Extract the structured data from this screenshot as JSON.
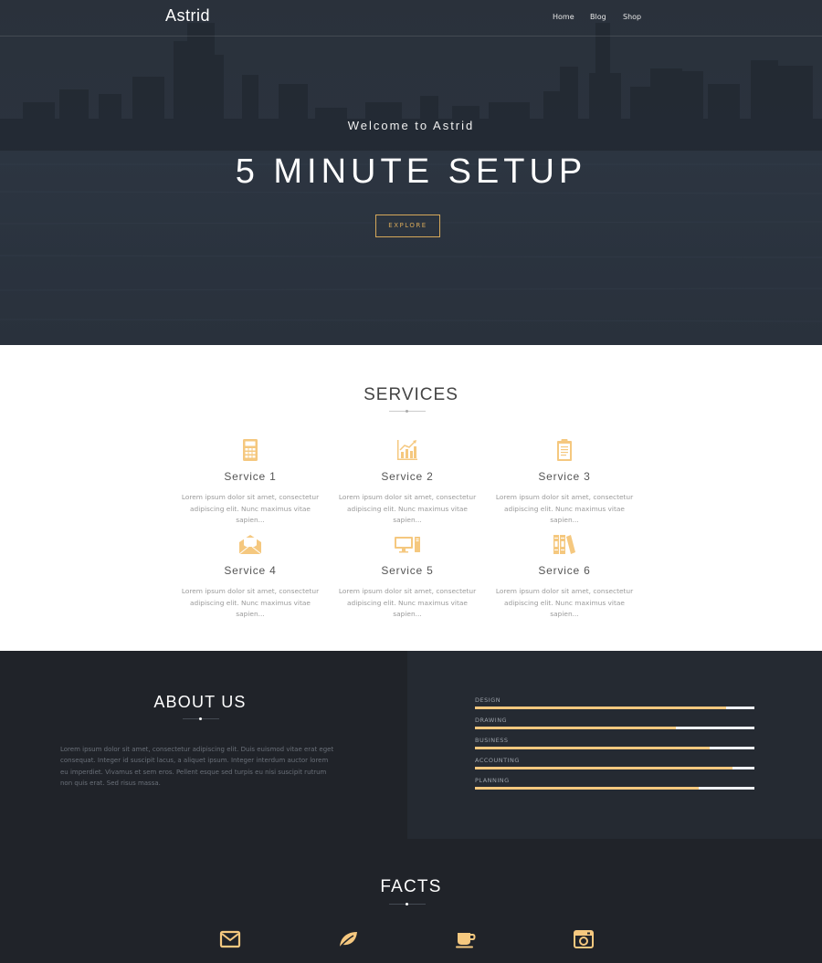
{
  "colors": {
    "accent": "#f5c87f",
    "dark": "#202329",
    "panel": "#252a32",
    "explore_border": "#d6a85a"
  },
  "nav": {
    "logo": "Astrid",
    "items": [
      "Home",
      "Blog",
      "Shop"
    ]
  },
  "hero": {
    "welcome": "Welcome to Astrid",
    "headline": "5 MINUTE SETUP",
    "button": "EXPLORE"
  },
  "services": {
    "title": "SERVICES",
    "items": [
      {
        "name": "Service 1",
        "icon": "calculator-icon",
        "text": "Lorem ipsum dolor sit amet, consectetur adipiscing elit. Nunc maximus vitae sapien..."
      },
      {
        "name": "Service 2",
        "icon": "chart-icon",
        "text": "Lorem ipsum dolor sit amet, consectetur adipiscing elit. Nunc maximus vitae sapien..."
      },
      {
        "name": "Service 3",
        "icon": "clipboard-icon",
        "text": "Lorem ipsum dolor sit amet, consectetur adipiscing elit. Nunc maximus vitae sapien..."
      },
      {
        "name": "Service 4",
        "icon": "envelope-open-icon",
        "text": "Lorem ipsum dolor sit amet, consectetur adipiscing elit. Nunc maximus vitae sapien..."
      },
      {
        "name": "Service 5",
        "icon": "desktop-computer-icon",
        "text": "Lorem ipsum dolor sit amet, consectetur adipiscing elit. Nunc maximus vitae sapien..."
      },
      {
        "name": "Service 6",
        "icon": "books-icon",
        "text": "Lorem ipsum dolor sit amet, consectetur adipiscing elit. Nunc maximus vitae sapien..."
      }
    ]
  },
  "about": {
    "title": "ABOUT US",
    "text": "Lorem ipsum dolor sit amet, consectetur adipiscing elit. Duis euismod vitae erat eget consequat. Integer id suscipit lacus, a aliquet ipsum. Integer interdum auctor lorem eu imperdiet. Vivamus et sem eros. Pellent esque sed turpis eu nisi suscipit rutrum non quis erat. Sed risus massa.",
    "skills": [
      {
        "label": "DESIGN",
        "percent": 90
      },
      {
        "label": "DRAWING",
        "percent": 72
      },
      {
        "label": "BUSINESS",
        "percent": 84
      },
      {
        "label": "ACCOUNTING",
        "percent": 92
      },
      {
        "label": "PLANNING",
        "percent": 80
      }
    ]
  },
  "facts": {
    "title": "FACTS",
    "icons": [
      "envelope-icon",
      "leaf-icon",
      "coffee-cup-icon",
      "camera-icon"
    ]
  }
}
